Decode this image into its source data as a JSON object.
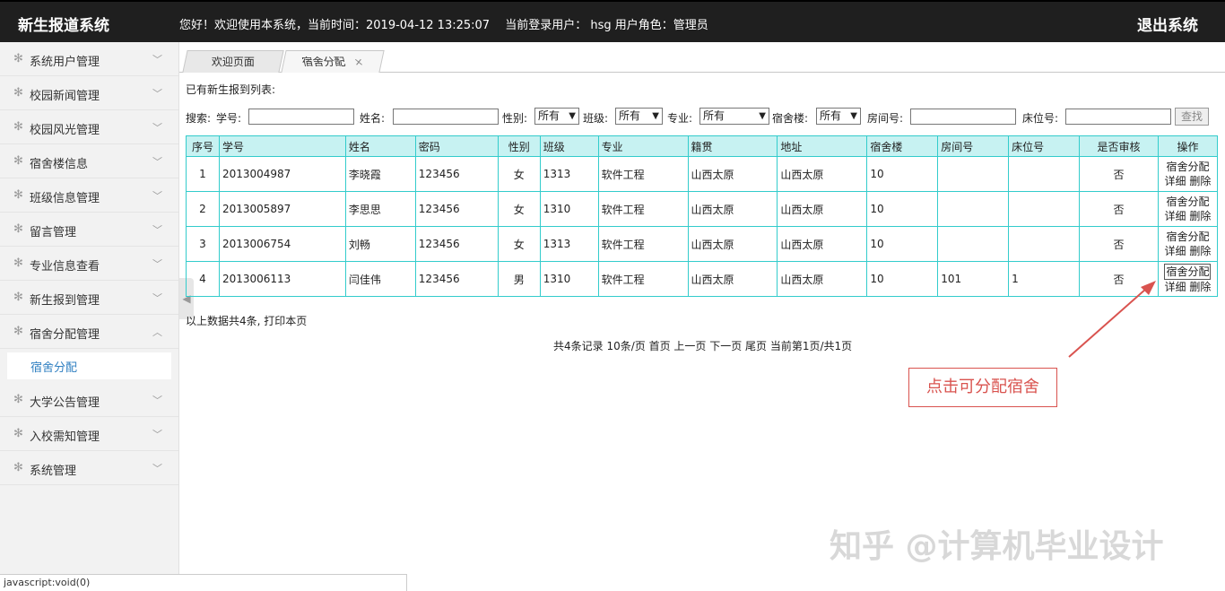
{
  "header": {
    "title": "新生报道系统",
    "welcome": "您好！欢迎使用本系统，当前时间：2019-04-12 13:25:07　 当前登录用户：  hsg  用户角色：管理员",
    "logout": "退出系统"
  },
  "sidebar": {
    "items": [
      {
        "label": "系统用户管理"
      },
      {
        "label": "校园新闻管理"
      },
      {
        "label": "校园风光管理"
      },
      {
        "label": "宿舍楼信息"
      },
      {
        "label": "班级信息管理"
      },
      {
        "label": "留言管理"
      },
      {
        "label": "专业信息查看"
      },
      {
        "label": "新生报到管理"
      },
      {
        "label": "宿舍分配管理"
      },
      {
        "label": "大学公告管理"
      },
      {
        "label": "入校需知管理"
      },
      {
        "label": "系统管理"
      }
    ],
    "submenu_label": "宿舍分配"
  },
  "tabs": [
    {
      "label": "欢迎页面"
    },
    {
      "label": "宿舍分配",
      "close": "×"
    }
  ],
  "content": {
    "list_title": "已有新生报到列表:",
    "search": {
      "label": "搜索:",
      "student_no": "学号:",
      "name": "姓名:",
      "gender": "性别:",
      "gender_value": "所有",
      "class": "班级:",
      "class_value": "所有",
      "major": "专业:",
      "major_value": "所有",
      "building": "宿舍楼:",
      "building_value": "所有",
      "room": "房间号:",
      "bed": "床位号:",
      "button": "查找"
    },
    "table": {
      "headers": [
        "序号",
        "学号",
        "姓名",
        "密码",
        "性别",
        "班级",
        "专业",
        "籍贯",
        "地址",
        "宿舍楼",
        "房间号",
        "床位号",
        "是否审核",
        "操作"
      ],
      "rows": [
        [
          "1",
          "2013004987",
          "李晓霞",
          "123456",
          "女",
          "1313",
          "软件工程",
          "山西太原",
          "山西太原",
          "10",
          "",
          "",
          "否"
        ],
        [
          "2",
          "2013005897",
          "李思思",
          "123456",
          "女",
          "1310",
          "软件工程",
          "山西太原",
          "山西太原",
          "10",
          "",
          "",
          "否"
        ],
        [
          "3",
          "2013006754",
          "刘畅",
          "123456",
          "女",
          "1313",
          "软件工程",
          "山西太原",
          "山西太原",
          "10",
          "",
          "",
          "否"
        ],
        [
          "4",
          "2013006113",
          "闫佳伟",
          "123456",
          "男",
          "1310",
          "软件工程",
          "山西太原",
          "山西太原",
          "10",
          "101",
          "1",
          "否"
        ]
      ],
      "op_assign": "宿舍分配",
      "op_detail": "详细",
      "op_delete": "删除"
    },
    "summary": "以上数据共4条, 打印本页",
    "pager": "共4条记录  10条/页 首页 上一页 下一页 尾页 当前第1页/共1页"
  },
  "annotation": {
    "callout": "点击可分配宿舍",
    "color": "#d9534f"
  },
  "watermark": "知乎 @计算机毕业设计",
  "statusbar": "javascript:void(0)"
}
